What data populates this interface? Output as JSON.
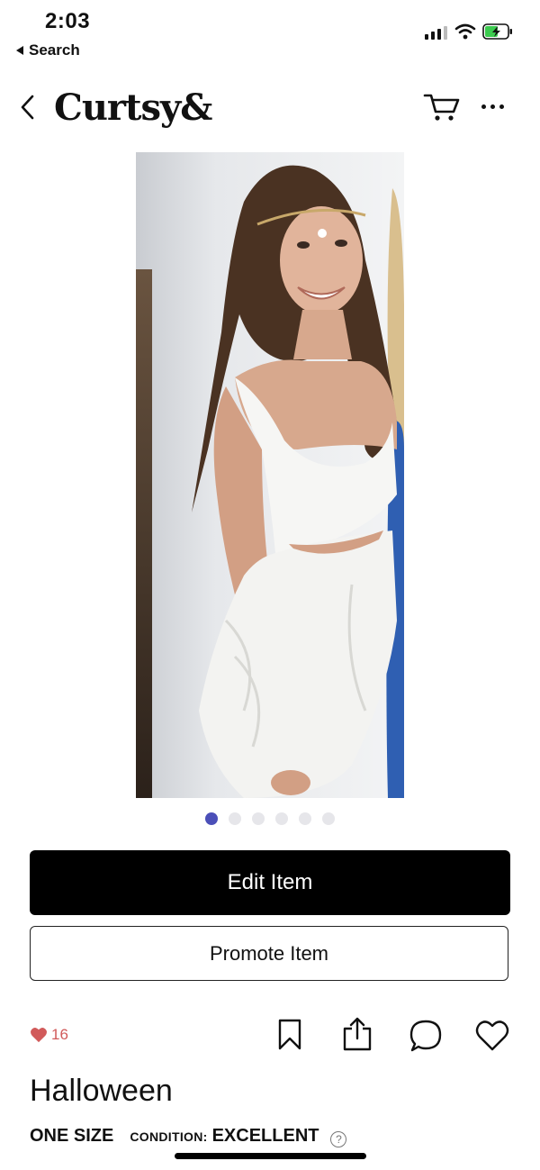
{
  "status_bar": {
    "time": "2:03",
    "back_app_label": "Search"
  },
  "header": {
    "brand": "Curtsy&"
  },
  "carousel": {
    "total": 6,
    "active_index": 0
  },
  "actions": {
    "edit_label": "Edit Item",
    "promote_label": "Promote Item"
  },
  "social": {
    "likes_count": "16"
  },
  "item": {
    "title": "Halloween",
    "size": "ONE SIZE",
    "condition_label": "CONDITION:",
    "condition_value": "EXCELLENT",
    "help_glyph": "?"
  },
  "colors": {
    "accent_dot": "#4b4fb8",
    "like_red": "#d15a5a",
    "primary_button": "#000000"
  },
  "icons": [
    "back-chevron-icon",
    "cart-icon",
    "more-icon",
    "heart-filled-icon",
    "bookmark-icon",
    "share-icon",
    "comment-icon",
    "heart-outline-icon",
    "help-icon"
  ]
}
